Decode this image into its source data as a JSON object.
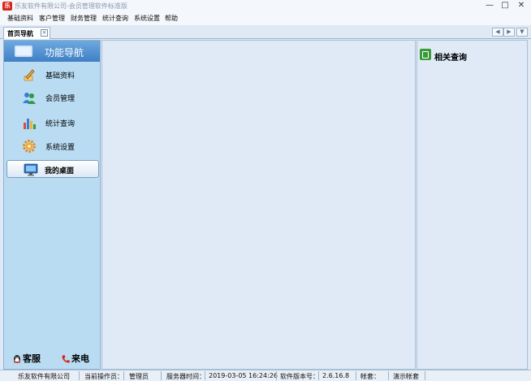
{
  "window": {
    "title": "乐友软件有限公司-会员管理软件标准版",
    "icon_text": "乐",
    "controls": {
      "minimize": "—",
      "maximize": "□",
      "close": "✕"
    }
  },
  "menu": [
    "基础资料",
    "客户管理",
    "财务管理",
    "统计查询",
    "系统设置",
    "帮助"
  ],
  "tab": {
    "label": "首页导航",
    "close": "×"
  },
  "tab_nav": {
    "prev": "◀",
    "next": "▶",
    "menu": "▼"
  },
  "sidebar": {
    "header": "功能导航",
    "items": [
      {
        "label": "基础资料",
        "icon": "pencil-icon"
      },
      {
        "label": "会员管理",
        "icon": "users-icon"
      },
      {
        "label": "统计查询",
        "icon": "bar-chart-icon"
      },
      {
        "label": "系统设置",
        "icon": "gear-icon"
      },
      {
        "label": "我的桌面",
        "icon": "monitor-icon",
        "active": true
      }
    ],
    "footer": [
      {
        "label": "客服",
        "icon": "qq-penguin-icon"
      },
      {
        "label": "来电",
        "icon": "phone-icon"
      }
    ]
  },
  "right_panel": {
    "title": "相关查询"
  },
  "statusbar": {
    "company": "乐友软件有限公司",
    "operator_label": "当前操作员：",
    "operator": "管理员",
    "server_time_label": "服务器时间：",
    "server_time": "2019-03-05 16:24:26",
    "version_label": "软件版本号：",
    "version": "2.6.16.8",
    "account_label": "帐套：",
    "account": "演示帐套"
  },
  "colors": {
    "sidebar_bg": "#b9dcf3",
    "header_blue": "#3f7fc4",
    "content_bg": "#dfeaf6"
  }
}
